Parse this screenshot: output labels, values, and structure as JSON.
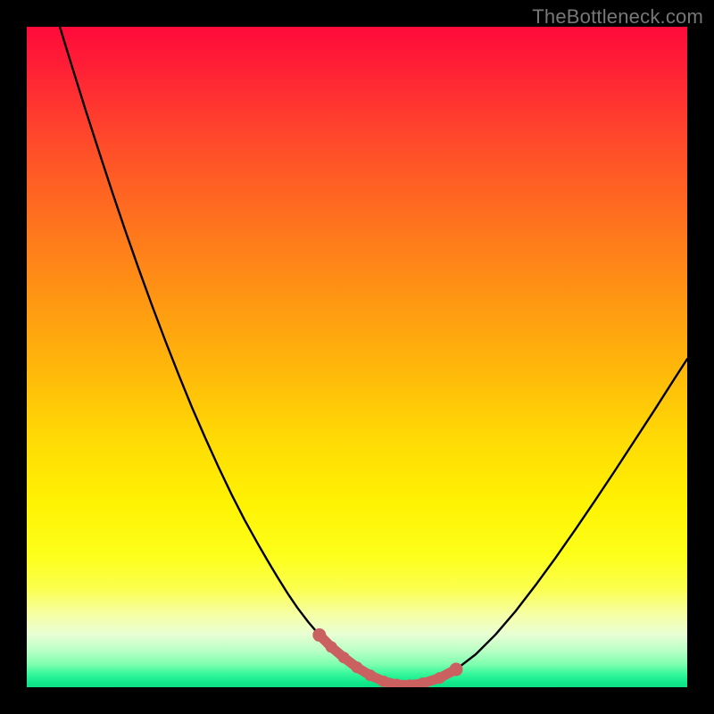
{
  "watermark": "TheBottleneck.com",
  "colors": {
    "background": "#000000",
    "curve": "#000000",
    "highlight_stroke": "#cb6061",
    "highlight_fill": "#cb6061"
  },
  "chart_data": {
    "type": "line",
    "title": "",
    "xlabel": "",
    "ylabel": "",
    "xlim": [
      0,
      100
    ],
    "ylim": [
      0,
      100
    ],
    "grid": false,
    "series": [
      {
        "name": "bottleneck-curve",
        "x": [
          5,
          7,
          9,
          11,
          13,
          15,
          17,
          19,
          21,
          23,
          25,
          27,
          29,
          31,
          33,
          35,
          36.5,
          38,
          39.5,
          41,
          42.6,
          44.3,
          46.1,
          48,
          50,
          52,
          54,
          56,
          58,
          60,
          62.5,
          65,
          68,
          71,
          74,
          77,
          80,
          83,
          86,
          89,
          92,
          95,
          98,
          100
        ],
        "y": [
          100,
          93.5,
          87.1,
          80.9,
          74.8,
          68.9,
          63.2,
          57.7,
          52.4,
          47.3,
          42.4,
          37.8,
          33.4,
          29.2,
          25.3,
          21.7,
          19.1,
          16.6,
          14.2,
          12.0,
          9.9,
          7.9,
          6.1,
          4.5,
          3.0,
          1.8,
          0.9,
          0.4,
          0.3,
          0.6,
          1.4,
          2.7,
          5.0,
          8.0,
          11.5,
          15.4,
          19.5,
          23.8,
          28.2,
          32.7,
          37.3,
          41.9,
          46.6,
          49.7
        ]
      }
    ],
    "highlight": {
      "name": "optimal-range",
      "points_x": [
        44.3,
        46.1,
        48,
        50,
        52,
        54,
        56,
        58,
        60,
        62.5,
        65
      ],
      "points_y": [
        7.9,
        6.1,
        4.5,
        3.0,
        1.8,
        0.9,
        0.4,
        0.3,
        0.6,
        1.4,
        2.7
      ]
    }
  }
}
